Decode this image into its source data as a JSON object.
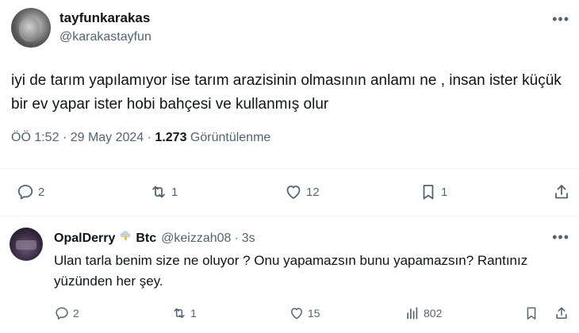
{
  "main_tweet": {
    "display_name": "tayfunkarakas",
    "handle": "@karakastayfun",
    "more_icon": "more-dots-icon",
    "text": "iyi de tarım yapılamıyor ise tarım arazisinin olmasının anlamı ne , insan ister küçük bir ev yapar ister hobi bahçesi ve kullanmış olur",
    "meta_time": "ÖÖ 1:52 · 29 May 2024 · ",
    "view_count": "1.273",
    "view_label": " Görüntülenme",
    "actions": {
      "replies": "2",
      "retweets": "1",
      "likes": "12",
      "bookmarks": "1"
    }
  },
  "reply_tweet": {
    "display_name": "OpalDerry",
    "badge_icon": "lightning-cloud-icon",
    "display_name_suffix": "Btc",
    "handle": "@keizzah08",
    "separator": "·",
    "time": "3s",
    "text": "Ulan tarla benim size ne oluyor ? Onu yapamazsın bunu yapamazsın? Rantınız yüzünden her şey.",
    "actions": {
      "replies": "2",
      "retweets": "1",
      "likes": "15",
      "views": "802"
    }
  },
  "colors": {
    "text_primary": "#0f1419",
    "text_secondary": "#536471",
    "divider": "#eff3f4"
  }
}
